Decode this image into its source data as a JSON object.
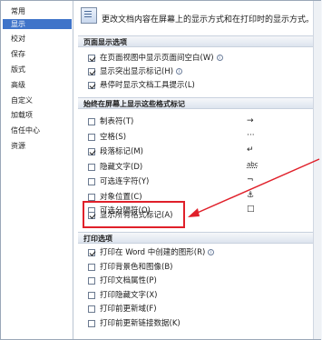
{
  "nav": {
    "items": [
      "常用",
      "显示",
      "校对",
      "保存",
      "版式",
      "高级",
      "自定义",
      "加载项",
      "信任中心",
      "资源"
    ],
    "selected_index": 1
  },
  "intro": {
    "text": "更改文档内容在屏幕上的显示方式和在打印时的显示方式。"
  },
  "sections": {
    "page_display": {
      "title": "页面显示选项"
    },
    "formatting_marks": {
      "title": "始终在屏幕上显示这些格式标记"
    },
    "print": {
      "title": "打印选项"
    }
  },
  "page_display_options": [
    {
      "label": "在页面视图中显示页面间空白(W)",
      "checked": true,
      "info": true
    },
    {
      "label": "显示突出显示标记(H)",
      "checked": true,
      "info": true
    },
    {
      "label": "悬停时显示文档工具提示(L)",
      "checked": true,
      "info": false
    }
  ],
  "format_marks": [
    {
      "label": "制表符(T)",
      "checked": false,
      "mark": "→"
    },
    {
      "label": "空格(S)",
      "checked": false,
      "mark": "···"
    },
    {
      "label": "段落标记(M)",
      "checked": true,
      "mark": "↵"
    },
    {
      "label": "隐藏文字(D)",
      "checked": false,
      "mark": "abc"
    },
    {
      "label": "可选连字符(Y)",
      "checked": false,
      "mark": "¬"
    },
    {
      "label": "对象位置(C)",
      "checked": false,
      "mark": "⚓"
    },
    {
      "label": "可选分隔符(O)",
      "checked": false,
      "mark": "□"
    },
    {
      "label": "显示所有格式标记(A)",
      "checked": true,
      "mark": ""
    }
  ],
  "print_options": [
    {
      "label": "打印在 Word 中创建的图形(R)",
      "checked": true,
      "info": true
    },
    {
      "label": "打印背景色和图像(B)",
      "checked": false,
      "info": false
    },
    {
      "label": "打印文档属性(P)",
      "checked": false,
      "info": false
    },
    {
      "label": "打印隐藏文字(X)",
      "checked": false,
      "info": false
    },
    {
      "label": "打印前更新域(F)",
      "checked": false,
      "info": false
    },
    {
      "label": "打印前更新链接数据(K)",
      "checked": false,
      "info": false
    }
  ],
  "colors": {
    "selected_nav": "#3f74c9",
    "annotation_red": "#e0202a"
  }
}
